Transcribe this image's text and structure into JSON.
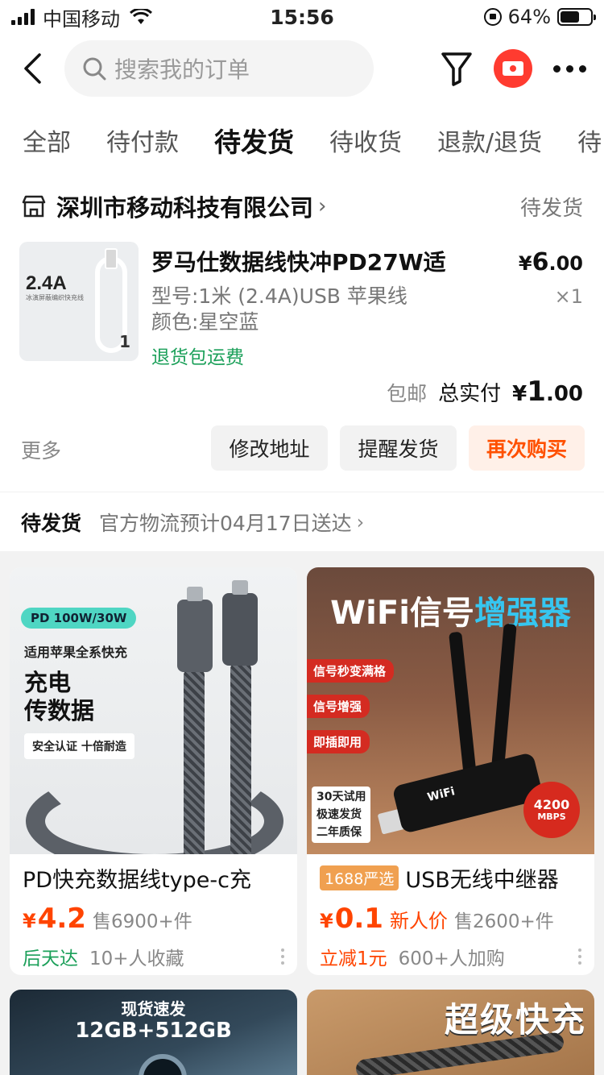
{
  "status_bar": {
    "carrier": "中国移动",
    "time": "15:56",
    "battery": "64%",
    "battery_level": 0.64
  },
  "header": {
    "search_placeholder": "搜索我的订单"
  },
  "tabs": [
    {
      "label": "全部",
      "active": false
    },
    {
      "label": "待付款",
      "active": false
    },
    {
      "label": "待发货",
      "active": true
    },
    {
      "label": "待收货",
      "active": false
    },
    {
      "label": "退款/退货",
      "active": false
    },
    {
      "label": "待",
      "active": false
    }
  ],
  "order": {
    "shop_name": "深圳市移动科技有限公司",
    "status": "待发货",
    "thumb_text": "2.4A",
    "thumb_sub": "冰演屏蔽编织快充线",
    "thumb_num": "1",
    "product_title": "罗马仕数据线快冲PD27W适",
    "spec_model": "型号:1米 (2.4A)USB 苹果线",
    "spec_color": "颜色:星空蓝",
    "service_tag": "退货包运费",
    "price_currency": "¥",
    "price_int": "6",
    "price_dec": ".00",
    "quantity": "×1",
    "shipping": "包邮",
    "total_label": "总实付",
    "total_currency": "¥",
    "total_int": "1",
    "total_dec": ".00",
    "more": "更多",
    "buttons": {
      "modify_address": "修改地址",
      "remind_ship": "提醒发货",
      "buy_again": "再次购买"
    }
  },
  "logistics": {
    "status": "待发货",
    "text": "官方物流预计04月17日送达"
  },
  "recommend": [
    {
      "title": "PD快充数据线type-c充",
      "badge": "",
      "price_currency": "¥",
      "price": "4.2",
      "new_price_label": "",
      "sold": "售6900+件",
      "tag": "后天达",
      "meta": "10+人收藏",
      "img": {
        "pill": "PD 100W/30W",
        "l1": "适用苹果全系快充",
        "l2": "充电\n传数据",
        "l3": "安全认证 十倍耐造"
      }
    },
    {
      "title": "USB无线中继器",
      "badge": "1688严选",
      "price_currency": "¥",
      "price": "0.1",
      "new_price_label": "新人价",
      "sold": "售2600+件",
      "tag": "立减1元",
      "meta": "600+人加购",
      "img": {
        "title_a": "WiFi信号",
        "title_b": "增强器",
        "t1": "信号秒变满格",
        "t2": "信号增强",
        "t3": "即插即用",
        "side": "30天试用\n极速发货\n二年质保",
        "dev": "WiFi",
        "mbps": "4200",
        "mbps_unit": "MBPS"
      }
    }
  ],
  "partial_cards": [
    {
      "a": "现货速发",
      "b": "12GB+512GB"
    },
    {
      "a": "超级快充"
    }
  ]
}
